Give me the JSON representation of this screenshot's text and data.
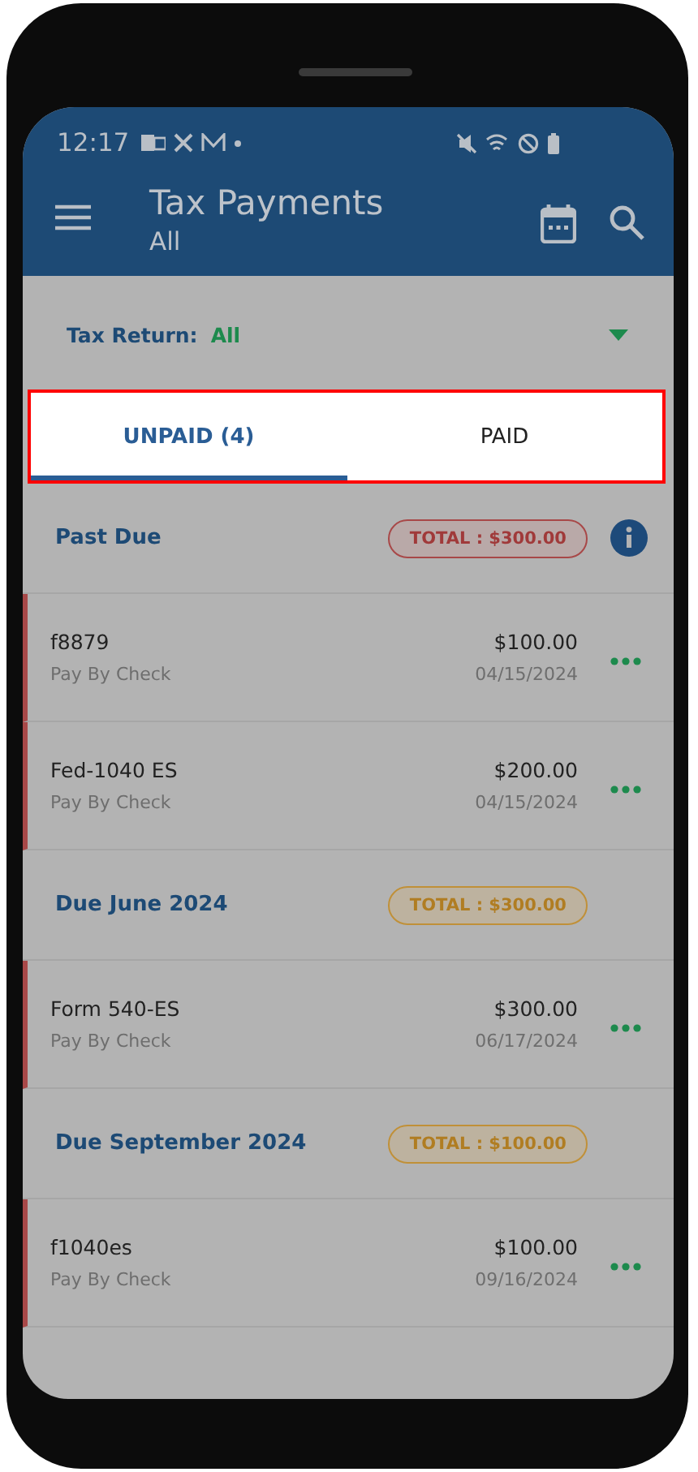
{
  "status_bar": {
    "time": "12:17"
  },
  "app_bar": {
    "title": "Tax Payments",
    "subtitle": "All"
  },
  "filter": {
    "label": "Tax Return:",
    "value": "All"
  },
  "tabs": [
    {
      "label": "UNPAID (4)",
      "selected": true
    },
    {
      "label": "PAID",
      "selected": false
    }
  ],
  "groups": [
    {
      "title": "Past Due",
      "total": "TOTAL : $300.00",
      "kind": "overdue",
      "info": true,
      "items": [
        {
          "name": "f8879",
          "method": "Pay By Check",
          "amount": "$100.00",
          "date": "04/15/2024"
        },
        {
          "name": "Fed-1040 ES",
          "method": "Pay By Check",
          "amount": "$200.00",
          "date": "04/15/2024"
        }
      ]
    },
    {
      "title": "Due June 2024",
      "total": "TOTAL : $300.00",
      "kind": "upcoming",
      "info": false,
      "items": [
        {
          "name": "Form 540-ES",
          "method": "Pay By Check",
          "amount": "$300.00",
          "date": "06/17/2024"
        }
      ]
    },
    {
      "title": "Due September 2024",
      "total": "TOTAL : $100.00",
      "kind": "upcoming",
      "info": false,
      "items": [
        {
          "name": "f1040es",
          "method": "Pay By Check",
          "amount": "$100.00",
          "date": "09/16/2024"
        }
      ]
    }
  ]
}
